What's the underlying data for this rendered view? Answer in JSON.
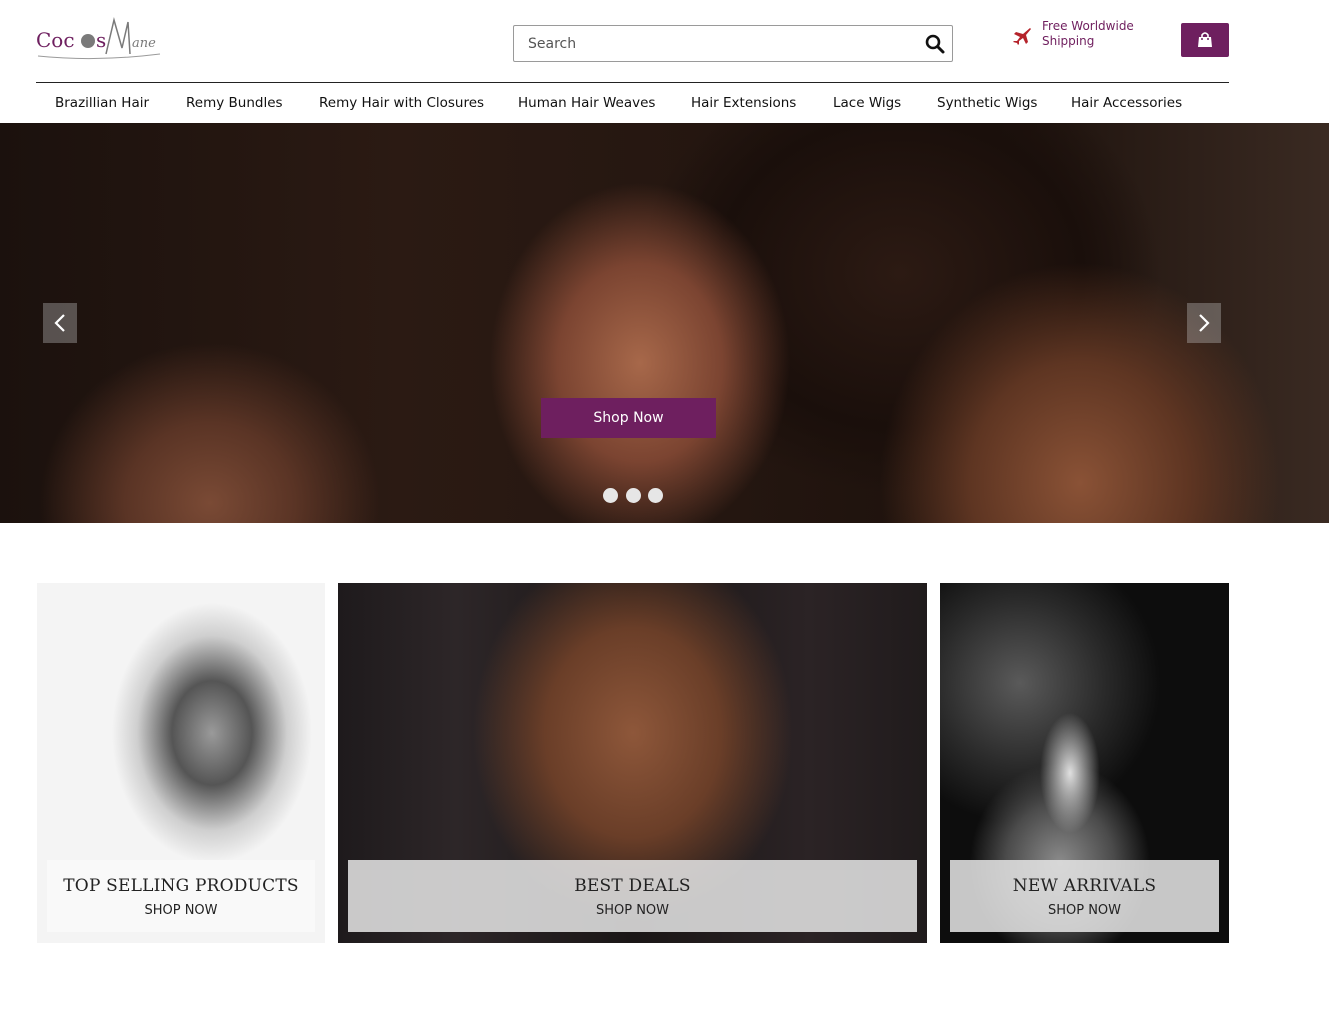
{
  "header": {
    "logo_text": "CocosMane",
    "search_placeholder": "Search",
    "shipping_line1": "Free Worldwide",
    "shipping_line2": "Shipping"
  },
  "nav": {
    "items": [
      {
        "label": "Brazillian Hair"
      },
      {
        "label": "Remy Bundles"
      },
      {
        "label": "Remy Hair with Closures"
      },
      {
        "label": "Human Hair Weaves"
      },
      {
        "label": "Hair Extensions"
      },
      {
        "label": "Lace Wigs"
      },
      {
        "label": "Synthetic Wigs"
      },
      {
        "label": "Hair Accessories"
      }
    ]
  },
  "hero": {
    "cta_label": "Shop Now",
    "slide_count": 3,
    "active_slide": 2
  },
  "tiles": [
    {
      "title": "TOP SELLING PRODUCTS",
      "cta": "SHOP NOW"
    },
    {
      "title": "BEST DEALS",
      "cta": "SHOP NOW"
    },
    {
      "title": "NEW ARRIVALS",
      "cta": "SHOP NOW"
    }
  ],
  "colors": {
    "brand": "#6e1f5f",
    "shipping_icon": "#b5232b",
    "logo_gray": "#7a7a7a"
  },
  "icons": {
    "search": "search-icon",
    "shipping": "plane-icon",
    "cart": "shopping-bag-icon",
    "prev": "chevron-left-icon",
    "next": "chevron-right-icon"
  }
}
